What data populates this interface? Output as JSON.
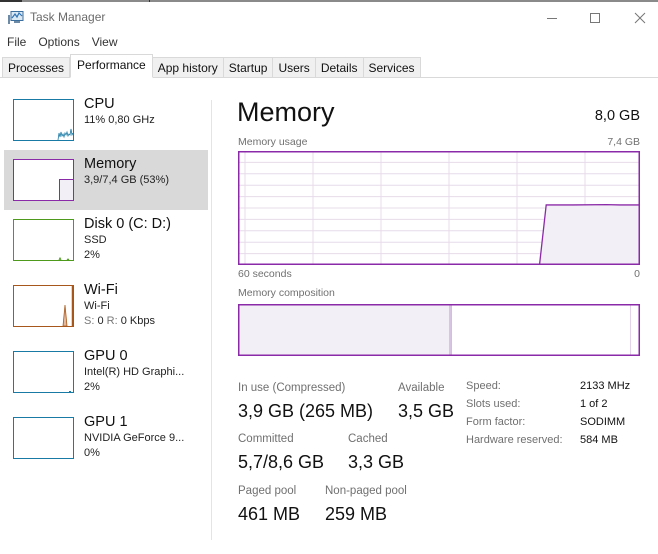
{
  "window": {
    "title": "Task Manager",
    "icon": "task-manager-icon",
    "controls": {
      "minimize": "minimize-icon",
      "maximize": "maximize-icon",
      "close": "close-icon"
    }
  },
  "menu": [
    "File",
    "Options",
    "View"
  ],
  "tabs": [
    {
      "label": "Processes",
      "active": false
    },
    {
      "label": "Performance",
      "active": true
    },
    {
      "label": "App history",
      "active": false
    },
    {
      "label": "Startup",
      "active": false
    },
    {
      "label": "Users",
      "active": false
    },
    {
      "label": "Details",
      "active": false
    },
    {
      "label": "Services",
      "active": false
    }
  ],
  "sidebar": {
    "items": [
      {
        "name": "CPU",
        "line1": "11% 0,80 GHz",
        "line2": "",
        "color": "#1a7aa6",
        "selected": false
      },
      {
        "name": "Memory",
        "line1": "3,9/7,4 GB (53%)",
        "line2": "",
        "color": "#8b2aa8",
        "selected": true
      },
      {
        "name": "Disk 0 (C: D:)",
        "line1": "SSD",
        "line2": "2%",
        "color": "#4d9a1c",
        "selected": false
      },
      {
        "name": "Wi-Fi",
        "line1": "Wi-Fi",
        "line2_parts": {
          "s_label": "S:",
          "s_value": "0",
          "r_label": "R:",
          "r_value": "0 Kbps"
        },
        "color": "#a7571b",
        "selected": false
      },
      {
        "name": "GPU 0",
        "line1": "Intel(R) HD Graphi...",
        "line2": "2%",
        "color": "#1a7aa6",
        "selected": false
      },
      {
        "name": "GPU 1",
        "line1": "NVIDIA GeForce 9...",
        "line2": "0%",
        "color": "#1a7aa6",
        "selected": false
      }
    ]
  },
  "main": {
    "title": "Memory",
    "total": "8,0 GB",
    "usage_chart": {
      "label": "Memory usage",
      "max_label": "7,4 GB",
      "x_left_label": "60 seconds",
      "x_right_label": "0",
      "color": "#8b2aa8",
      "fill": "#f3eff6",
      "grid_color": "#e6dcea",
      "max_gb": 7.4,
      "series_seconds_ago": [
        60,
        50,
        40,
        30,
        15,
        14,
        10,
        5,
        3,
        0
      ],
      "series_gb": [
        0,
        0,
        0,
        0,
        0,
        3.9,
        3.9,
        3.92,
        3.9,
        3.9
      ]
    },
    "composition": {
      "label": "Memory composition",
      "segments": [
        {
          "name": "In use",
          "fraction": 0.527,
          "color": "#f3eff6"
        },
        {
          "name": "Modified",
          "fraction": 0.005,
          "color": "#d9c3e2"
        },
        {
          "name": "Standby",
          "fraction": 0.445,
          "color": "#ffffff"
        },
        {
          "name": "Free",
          "fraction": 0.023,
          "color": "#ffffff"
        }
      ]
    },
    "stats": {
      "in_use_label": "In use (Compressed)",
      "in_use_value": "3,9 GB (265 MB)",
      "available_label": "Available",
      "available_value": "3,5 GB",
      "committed_label": "Committed",
      "committed_value": "5,7/8,6 GB",
      "cached_label": "Cached",
      "cached_value": "3,3 GB",
      "paged_label": "Paged pool",
      "paged_value": "461 MB",
      "nonpaged_label": "Non-paged pool",
      "nonpaged_value": "259 MB"
    },
    "specs": [
      {
        "label": "Speed:",
        "value": "2133 MHz"
      },
      {
        "label": "Slots used:",
        "value": "1 of 2"
      },
      {
        "label": "Form factor:",
        "value": "SODIMM"
      },
      {
        "label": "Hardware reserved:",
        "value": "584 MB"
      }
    ]
  }
}
